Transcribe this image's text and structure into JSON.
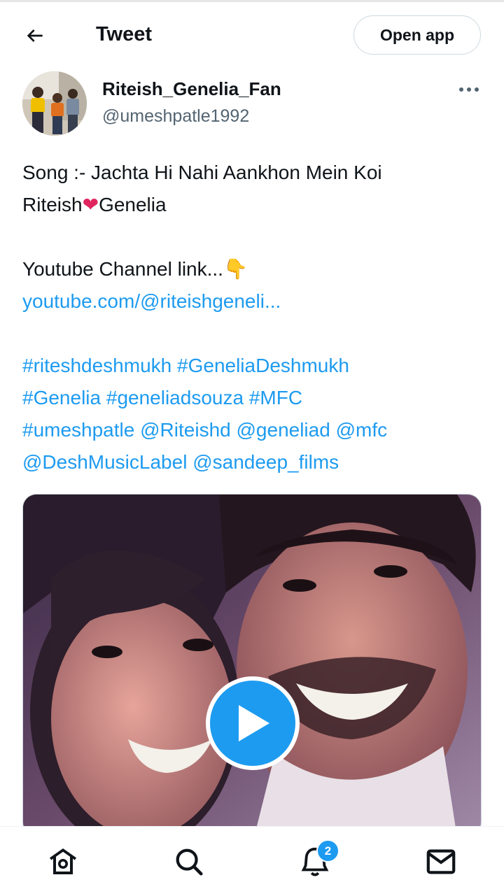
{
  "header": {
    "title": "Tweet",
    "open_app_label": "Open app"
  },
  "author": {
    "display_name": "Riteish_Genelia_Fan",
    "handle": "@umeshpatle1992"
  },
  "tweet": {
    "line1": "Song :- Jachta Hi Nahi Aankhon Mein Koi",
    "line2_a": "Riteish",
    "heart": "❤",
    "line2_b": "Genelia",
    "line3": "Youtube Channel link...",
    "pointing_emoji": "👇",
    "youtube_link": "youtube.com/@riteishgeneli...",
    "tags": [
      "#riteshdeshmukh",
      "#GeneliaDeshmukh",
      "#Genelia",
      "#geneliadsouza",
      "#MFC",
      "#umeshpatle"
    ],
    "mentions": [
      "@Riteishd",
      "@geneliad",
      "@mfc",
      "@DeshMusicLabel",
      "@sandeep_films"
    ]
  },
  "media": {
    "type": "video",
    "play_icon": "play-icon"
  },
  "bottom_nav": {
    "items": [
      "home-icon",
      "search-icon",
      "notifications-icon",
      "messages-icon"
    ],
    "notification_count": "2"
  },
  "colors": {
    "accent": "#1d9bf0",
    "text": "#0f1419",
    "muted": "#536471",
    "heart": "#e0245e"
  }
}
